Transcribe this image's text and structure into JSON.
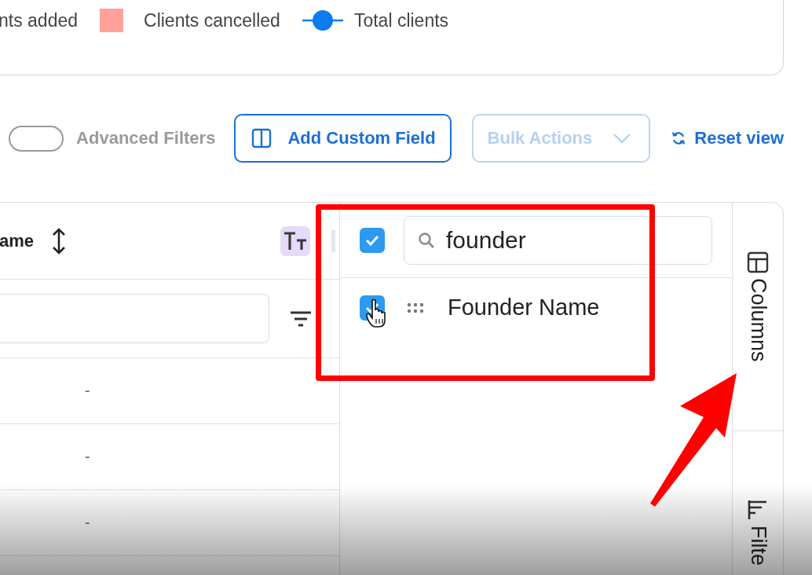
{
  "legend": [
    {
      "label": "nts added",
      "kind": "label"
    },
    {
      "label": "Clients cancelled",
      "kind": "swatch",
      "color": "#ffa19a"
    },
    {
      "label": "Total clients",
      "kind": "line",
      "color": "#0a7cf0"
    }
  ],
  "toolbar": {
    "advanced_filters": {
      "label": "Advanced Filters",
      "on": false
    },
    "buttons": [
      {
        "label": "Add Custom Field",
        "kind": "add-field",
        "disabled": false
      },
      {
        "label": "Bulk Actions",
        "kind": "dropdown",
        "disabled": true
      }
    ],
    "reset": {
      "label": "Reset view"
    }
  },
  "table": {
    "column_header": "ame",
    "rows": [
      {
        "cell": "-"
      },
      {
        "cell": "-"
      },
      {
        "cell": "-"
      }
    ]
  },
  "column_panel": {
    "select_all": {
      "checked": true
    },
    "search": {
      "value": "founder"
    },
    "items": [
      {
        "label": "Founder Name",
        "checked": true
      }
    ]
  },
  "side_tabs": [
    {
      "label": "Columns",
      "kind": "columns"
    },
    {
      "label": "Filte",
      "kind": "filters"
    }
  ]
}
